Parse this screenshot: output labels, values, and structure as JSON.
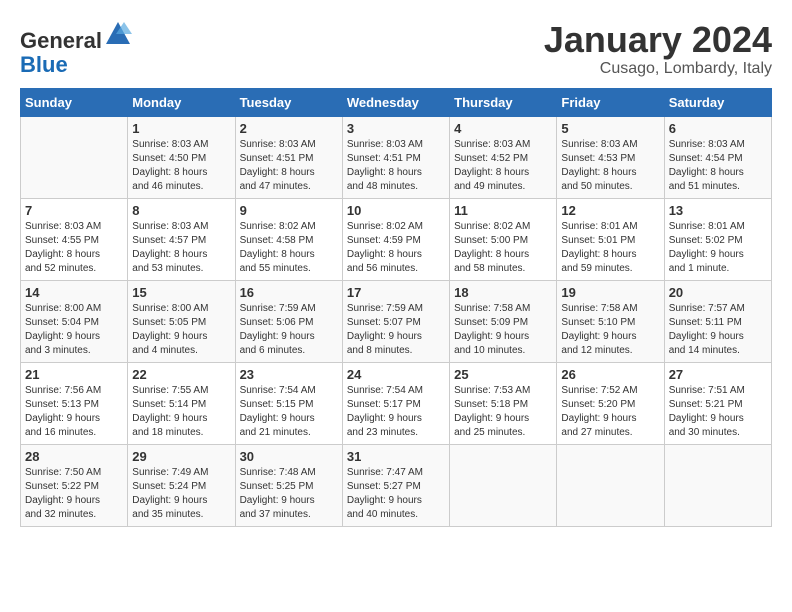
{
  "header": {
    "logo_general": "General",
    "logo_blue": "Blue",
    "month_title": "January 2024",
    "location": "Cusago, Lombardy, Italy"
  },
  "days_of_week": [
    "Sunday",
    "Monday",
    "Tuesday",
    "Wednesday",
    "Thursday",
    "Friday",
    "Saturday"
  ],
  "weeks": [
    [
      {
        "day": "",
        "info": ""
      },
      {
        "day": "1",
        "info": "Sunrise: 8:03 AM\nSunset: 4:50 PM\nDaylight: 8 hours\nand 46 minutes."
      },
      {
        "day": "2",
        "info": "Sunrise: 8:03 AM\nSunset: 4:51 PM\nDaylight: 8 hours\nand 47 minutes."
      },
      {
        "day": "3",
        "info": "Sunrise: 8:03 AM\nSunset: 4:51 PM\nDaylight: 8 hours\nand 48 minutes."
      },
      {
        "day": "4",
        "info": "Sunrise: 8:03 AM\nSunset: 4:52 PM\nDaylight: 8 hours\nand 49 minutes."
      },
      {
        "day": "5",
        "info": "Sunrise: 8:03 AM\nSunset: 4:53 PM\nDaylight: 8 hours\nand 50 minutes."
      },
      {
        "day": "6",
        "info": "Sunrise: 8:03 AM\nSunset: 4:54 PM\nDaylight: 8 hours\nand 51 minutes."
      }
    ],
    [
      {
        "day": "7",
        "info": "Sunrise: 8:03 AM\nSunset: 4:55 PM\nDaylight: 8 hours\nand 52 minutes."
      },
      {
        "day": "8",
        "info": "Sunrise: 8:03 AM\nSunset: 4:57 PM\nDaylight: 8 hours\nand 53 minutes."
      },
      {
        "day": "9",
        "info": "Sunrise: 8:02 AM\nSunset: 4:58 PM\nDaylight: 8 hours\nand 55 minutes."
      },
      {
        "day": "10",
        "info": "Sunrise: 8:02 AM\nSunset: 4:59 PM\nDaylight: 8 hours\nand 56 minutes."
      },
      {
        "day": "11",
        "info": "Sunrise: 8:02 AM\nSunset: 5:00 PM\nDaylight: 8 hours\nand 58 minutes."
      },
      {
        "day": "12",
        "info": "Sunrise: 8:01 AM\nSunset: 5:01 PM\nDaylight: 8 hours\nand 59 minutes."
      },
      {
        "day": "13",
        "info": "Sunrise: 8:01 AM\nSunset: 5:02 PM\nDaylight: 9 hours\nand 1 minute."
      }
    ],
    [
      {
        "day": "14",
        "info": "Sunrise: 8:00 AM\nSunset: 5:04 PM\nDaylight: 9 hours\nand 3 minutes."
      },
      {
        "day": "15",
        "info": "Sunrise: 8:00 AM\nSunset: 5:05 PM\nDaylight: 9 hours\nand 4 minutes."
      },
      {
        "day": "16",
        "info": "Sunrise: 7:59 AM\nSunset: 5:06 PM\nDaylight: 9 hours\nand 6 minutes."
      },
      {
        "day": "17",
        "info": "Sunrise: 7:59 AM\nSunset: 5:07 PM\nDaylight: 9 hours\nand 8 minutes."
      },
      {
        "day": "18",
        "info": "Sunrise: 7:58 AM\nSunset: 5:09 PM\nDaylight: 9 hours\nand 10 minutes."
      },
      {
        "day": "19",
        "info": "Sunrise: 7:58 AM\nSunset: 5:10 PM\nDaylight: 9 hours\nand 12 minutes."
      },
      {
        "day": "20",
        "info": "Sunrise: 7:57 AM\nSunset: 5:11 PM\nDaylight: 9 hours\nand 14 minutes."
      }
    ],
    [
      {
        "day": "21",
        "info": "Sunrise: 7:56 AM\nSunset: 5:13 PM\nDaylight: 9 hours\nand 16 minutes."
      },
      {
        "day": "22",
        "info": "Sunrise: 7:55 AM\nSunset: 5:14 PM\nDaylight: 9 hours\nand 18 minutes."
      },
      {
        "day": "23",
        "info": "Sunrise: 7:54 AM\nSunset: 5:15 PM\nDaylight: 9 hours\nand 21 minutes."
      },
      {
        "day": "24",
        "info": "Sunrise: 7:54 AM\nSunset: 5:17 PM\nDaylight: 9 hours\nand 23 minutes."
      },
      {
        "day": "25",
        "info": "Sunrise: 7:53 AM\nSunset: 5:18 PM\nDaylight: 9 hours\nand 25 minutes."
      },
      {
        "day": "26",
        "info": "Sunrise: 7:52 AM\nSunset: 5:20 PM\nDaylight: 9 hours\nand 27 minutes."
      },
      {
        "day": "27",
        "info": "Sunrise: 7:51 AM\nSunset: 5:21 PM\nDaylight: 9 hours\nand 30 minutes."
      }
    ],
    [
      {
        "day": "28",
        "info": "Sunrise: 7:50 AM\nSunset: 5:22 PM\nDaylight: 9 hours\nand 32 minutes."
      },
      {
        "day": "29",
        "info": "Sunrise: 7:49 AM\nSunset: 5:24 PM\nDaylight: 9 hours\nand 35 minutes."
      },
      {
        "day": "30",
        "info": "Sunrise: 7:48 AM\nSunset: 5:25 PM\nDaylight: 9 hours\nand 37 minutes."
      },
      {
        "day": "31",
        "info": "Sunrise: 7:47 AM\nSunset: 5:27 PM\nDaylight: 9 hours\nand 40 minutes."
      },
      {
        "day": "",
        "info": ""
      },
      {
        "day": "",
        "info": ""
      },
      {
        "day": "",
        "info": ""
      }
    ]
  ]
}
